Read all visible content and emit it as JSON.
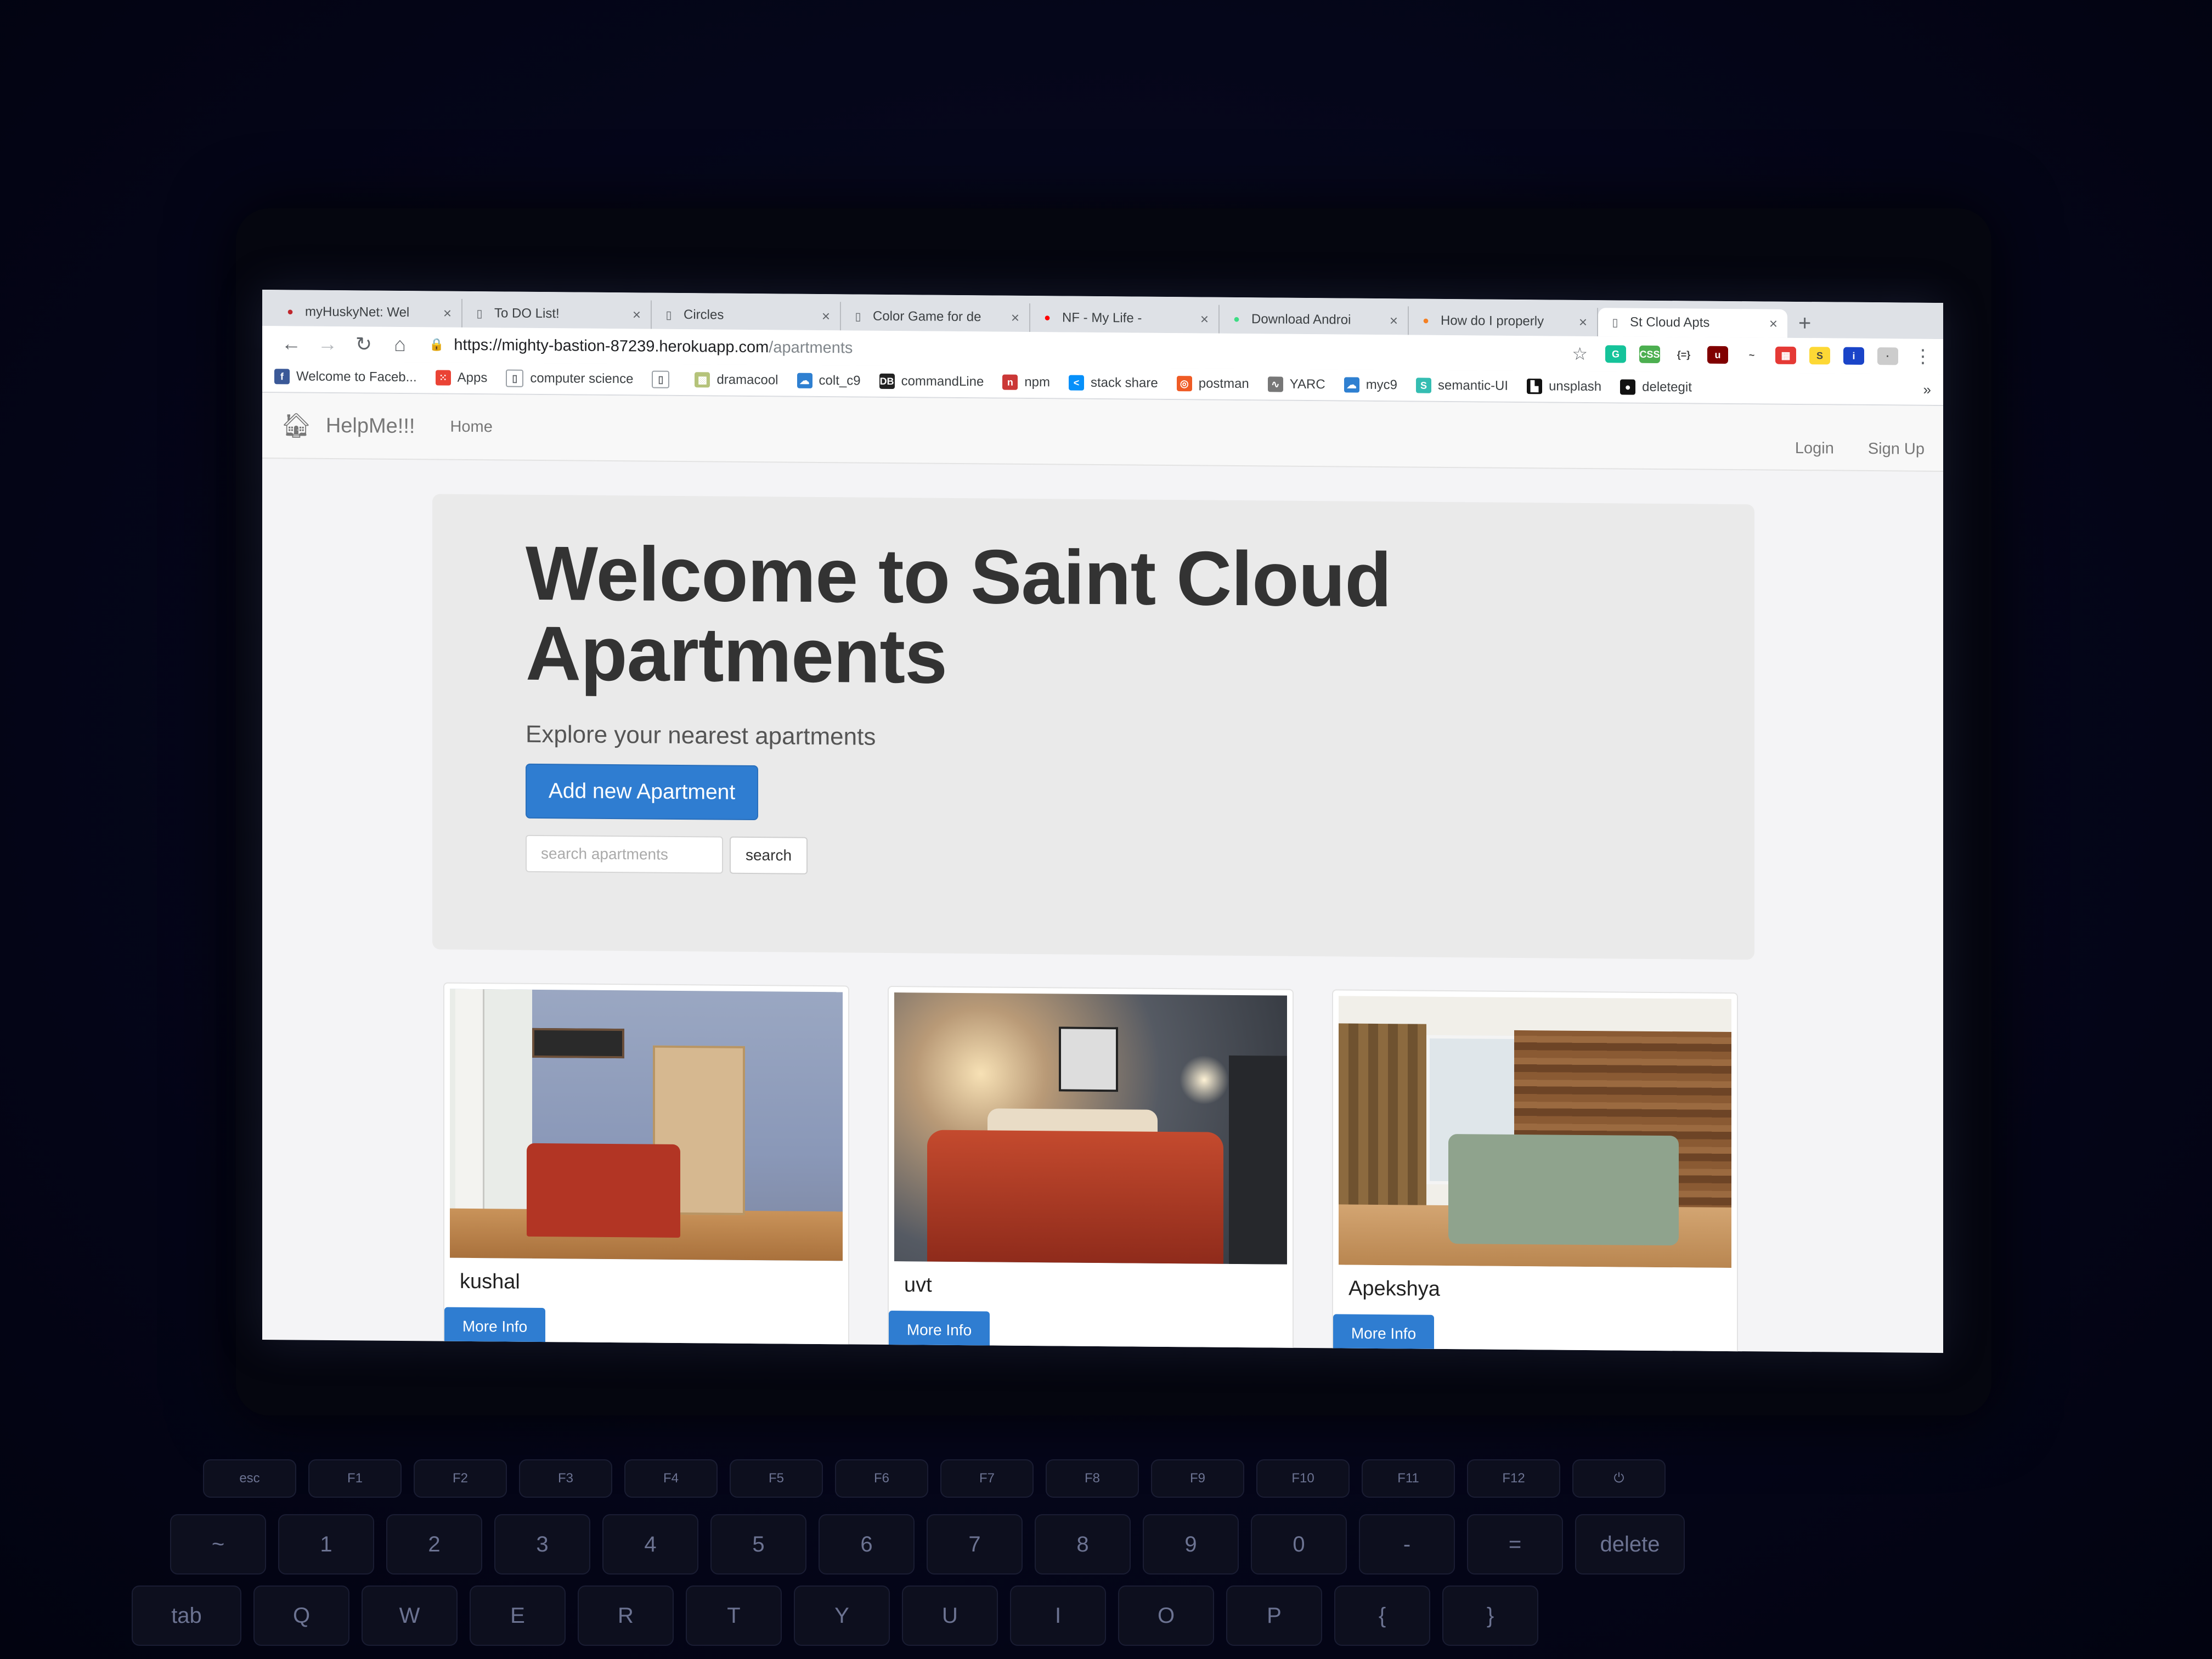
{
  "browser": {
    "tabs": [
      {
        "title": "myHuskyNet: Wel",
        "favicon": "huskynet-icon",
        "color": "#c0272d",
        "active": false
      },
      {
        "title": "To DO List!",
        "favicon": "page-icon",
        "color": "#5f6368",
        "active": false
      },
      {
        "title": "Circles",
        "favicon": "page-icon",
        "color": "#5f6368",
        "active": false
      },
      {
        "title": "Color Game for de",
        "favicon": "page-icon",
        "color": "#5f6368",
        "active": false
      },
      {
        "title": "NF - My Life -",
        "favicon": "youtube-icon",
        "color": "#ff0000",
        "active": false
      },
      {
        "title": "Download Androi",
        "favicon": "android-icon",
        "color": "#3ddc84",
        "active": false
      },
      {
        "title": "How do I properly",
        "favicon": "stackoverflow-icon",
        "color": "#f48024",
        "active": false
      },
      {
        "title": "St Cloud Apts",
        "favicon": "page-icon",
        "color": "#5f6368",
        "active": true
      }
    ],
    "new_tab": "+",
    "url_host": "https://mighty-bastion-87239.herokuapp.com",
    "url_path": "/apartments",
    "extensions": [
      {
        "name": "grammarly-icon",
        "color": "#15c39a",
        "label": "G"
      },
      {
        "name": "css-icon",
        "color": "#4caf50",
        "label": "CSS"
      },
      {
        "name": "json-icon",
        "color": "#ffffff",
        "label": "{=}"
      },
      {
        "name": "ublock-icon",
        "color": "#800000",
        "label": "u"
      },
      {
        "name": "wave-icon",
        "color": "#ffffff",
        "label": "~"
      },
      {
        "name": "colorpick-icon",
        "color": "#e53935",
        "label": "▦"
      },
      {
        "name": "extension-icon",
        "color": "#fdd835",
        "label": "S"
      },
      {
        "name": "info-icon",
        "color": "#1a44c8",
        "label": "i"
      },
      {
        "name": "profile-icon",
        "color": "#cccccc",
        "label": "·"
      }
    ],
    "bookmarks": [
      {
        "label": "Welcome to Faceb...",
        "icon": "facebook-icon",
        "color": "#3b5998",
        "glyph": "f"
      },
      {
        "label": "Apps",
        "icon": "apps-icon",
        "color": "#ea4335",
        "glyph": "⁙"
      },
      {
        "label": "computer science",
        "icon": "page-icon",
        "color": "#ffffff",
        "glyph": "▯"
      },
      {
        "label": "",
        "icon": "page-icon",
        "color": "#ffffff",
        "glyph": "▯"
      },
      {
        "label": "dramacool",
        "icon": "dramacool-icon",
        "color": "#b5c37a",
        "glyph": "▩"
      },
      {
        "label": "colt_c9",
        "icon": "cloud9-icon",
        "color": "#2f80d1",
        "glyph": "☁"
      },
      {
        "label": "commandLine",
        "icon": "commandline-icon",
        "color": "#222222",
        "glyph": "DB"
      },
      {
        "label": "npm",
        "icon": "npm-icon",
        "color": "#cb3837",
        "glyph": "n"
      },
      {
        "label": "stack share",
        "icon": "stackshare-icon",
        "color": "#0690fa",
        "glyph": "<"
      },
      {
        "label": "postman",
        "icon": "postman-icon",
        "color": "#ef5b25",
        "glyph": "◎"
      },
      {
        "label": "YARC",
        "icon": "yarc-icon",
        "color": "#777777",
        "glyph": "∿"
      },
      {
        "label": "myc9",
        "icon": "cloud9-icon",
        "color": "#2f80d1",
        "glyph": "☁"
      },
      {
        "label": "semantic-UI",
        "icon": "semantic-icon",
        "color": "#35bdb2",
        "glyph": "S"
      },
      {
        "label": "unsplash",
        "icon": "unsplash-icon",
        "color": "#111111",
        "glyph": "▙"
      },
      {
        "label": "deletegit",
        "icon": "github-icon",
        "color": "#111111",
        "glyph": "●"
      }
    ],
    "bookmarks_more": "»"
  },
  "site": {
    "brand": "HelpMe!!!",
    "nav_home": "Home",
    "nav_login": "Login",
    "nav_signup": "Sign Up",
    "hero_title": "Welcome to Saint Cloud Apartments",
    "hero_subtitle": "Explore your nearest apartments",
    "add_button": "Add new Apartment",
    "search_placeholder": "search apartments",
    "search_button": "search",
    "apartments": [
      {
        "name": "kushal",
        "button": "More Info"
      },
      {
        "name": "uvt",
        "button": "More Info"
      },
      {
        "name": "Apekshya",
        "button": "More Info"
      }
    ],
    "accent_color": "#2f7dd1"
  },
  "keyboard": {
    "fn_row": [
      "esc",
      "F1",
      "F2",
      "F3",
      "F4",
      "F5",
      "F6",
      "F7",
      "F8",
      "F9",
      "F10",
      "F11",
      "F12",
      "⏻"
    ],
    "num_row": [
      "~",
      "1",
      "2",
      "3",
      "4",
      "5",
      "6",
      "7",
      "8",
      "9",
      "0",
      "-",
      "=",
      "delete"
    ],
    "q_row": [
      "tab",
      "Q",
      "W",
      "E",
      "R",
      "T",
      "Y",
      "U",
      "I",
      "O",
      "P",
      "{",
      "}"
    ]
  }
}
